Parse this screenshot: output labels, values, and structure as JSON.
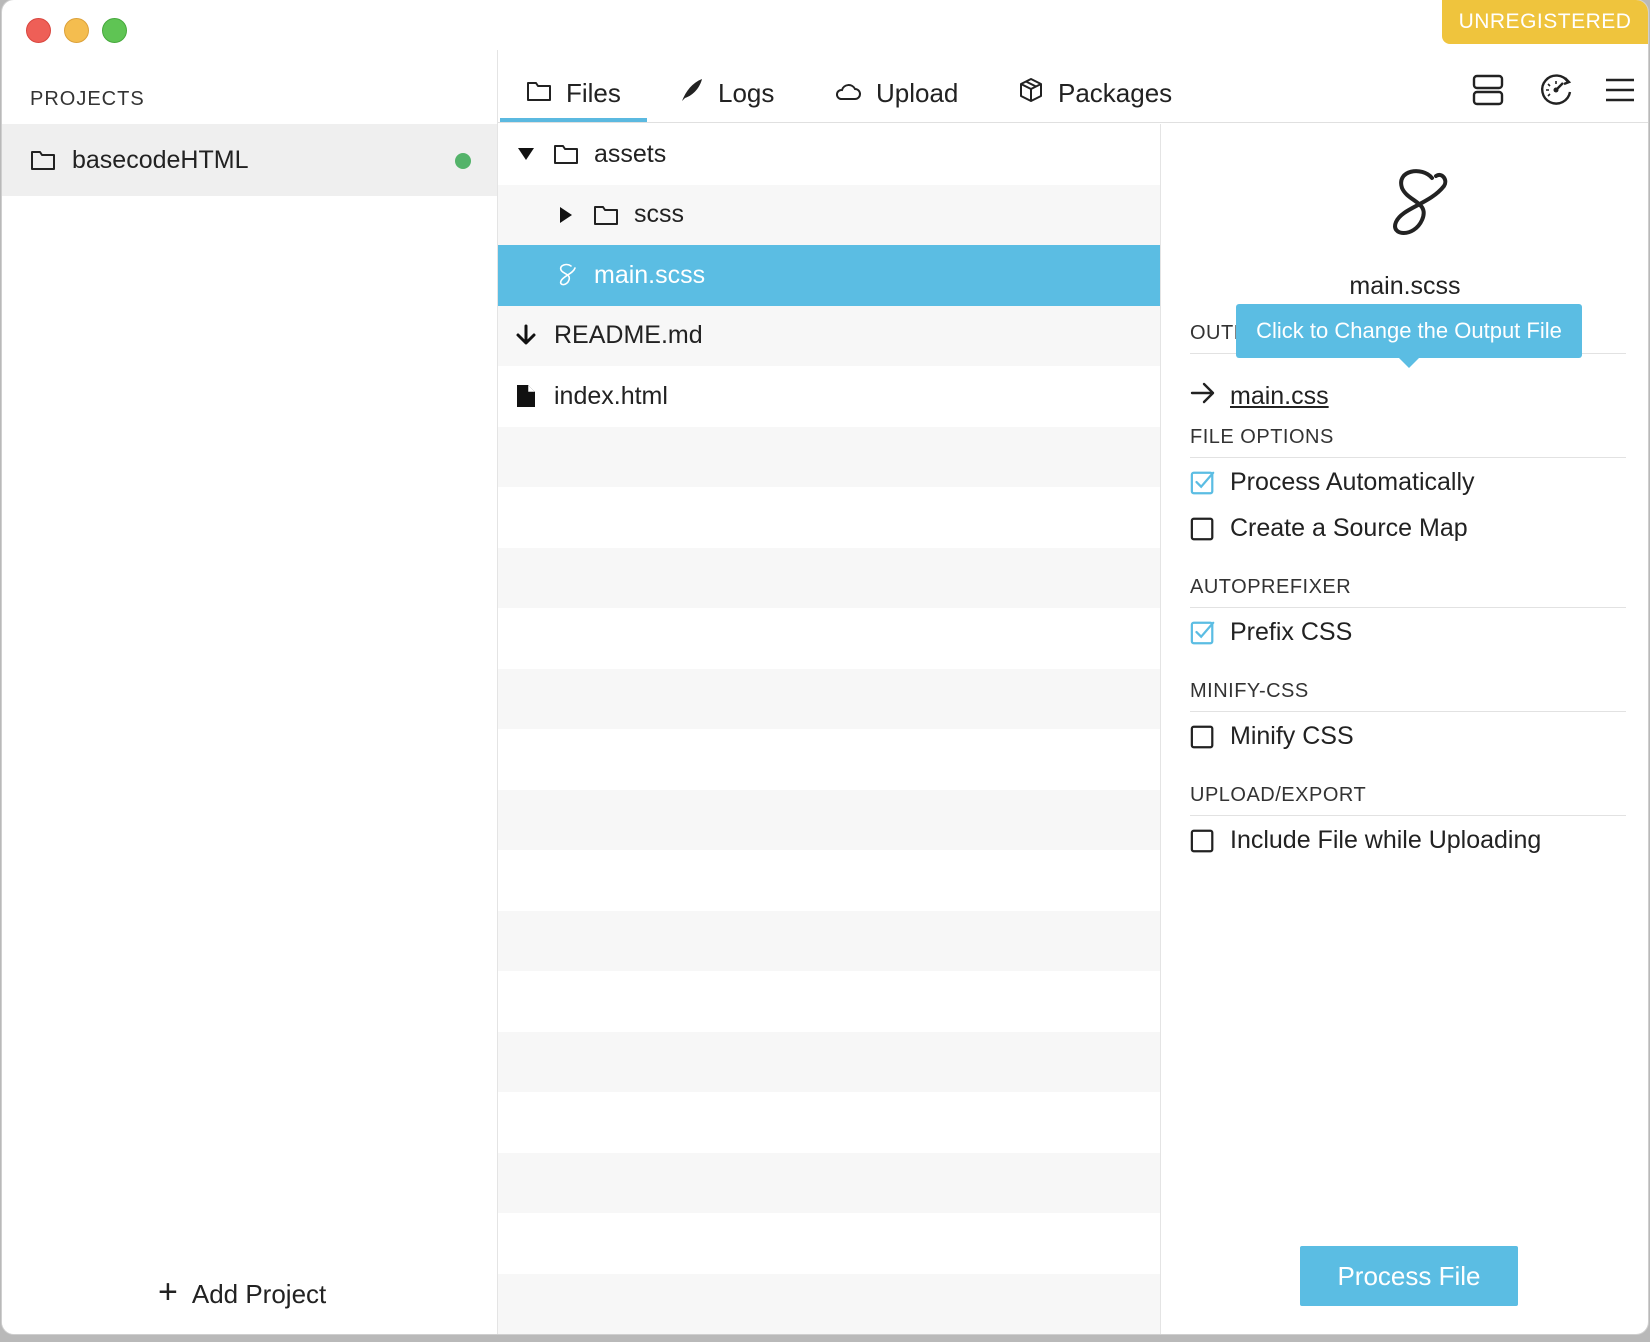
{
  "badge": {
    "label": "UNREGISTERED"
  },
  "sidebar": {
    "heading": "PROJECTS",
    "projects": [
      {
        "name": "basecodeHTML",
        "status_color": "#54b36a"
      }
    ],
    "add_label": "Add Project"
  },
  "tabs": [
    {
      "label": "Files",
      "icon": "folder-icon",
      "active": true
    },
    {
      "label": "Logs",
      "icon": "feather-icon",
      "active": false
    },
    {
      "label": "Upload",
      "icon": "cloud-icon",
      "active": false
    },
    {
      "label": "Packages",
      "icon": "package-icon",
      "active": false
    }
  ],
  "toolbar": {
    "icons": [
      "server-icon",
      "gauge-icon",
      "menu-icon"
    ]
  },
  "filetree": {
    "items": [
      {
        "name": "assets",
        "type": "folder",
        "expanded": true,
        "level": 0
      },
      {
        "name": "scss",
        "type": "folder",
        "expanded": false,
        "level": 1
      },
      {
        "name": "main.scss",
        "type": "sass",
        "selected": true,
        "level": 1
      },
      {
        "name": "README.md",
        "type": "download",
        "level": 0
      },
      {
        "name": "index.html",
        "type": "file",
        "level": 0
      }
    ]
  },
  "inspector": {
    "file_name": "main.scss",
    "tooltip": "Click to Change the Output File",
    "output_heading": "OUTPUT",
    "output_file": "main.css",
    "sections": [
      {
        "title": "FILE OPTIONS",
        "options": [
          {
            "label": "Process Automatically",
            "checked": true
          },
          {
            "label": "Create a Source Map",
            "checked": false
          }
        ]
      },
      {
        "title": "AUTOPREFIXER",
        "options": [
          {
            "label": "Prefix CSS",
            "checked": true
          }
        ]
      },
      {
        "title": "MINIFY-CSS",
        "options": [
          {
            "label": "Minify CSS",
            "checked": false
          }
        ]
      },
      {
        "title": "UPLOAD/EXPORT",
        "options": [
          {
            "label": "Include File while Uploading",
            "checked": false
          }
        ]
      }
    ],
    "process_label": "Process File"
  },
  "colors": {
    "accent": "#5bbde3",
    "badge": "#efc43d",
    "selected_row": "#5bbde3"
  }
}
